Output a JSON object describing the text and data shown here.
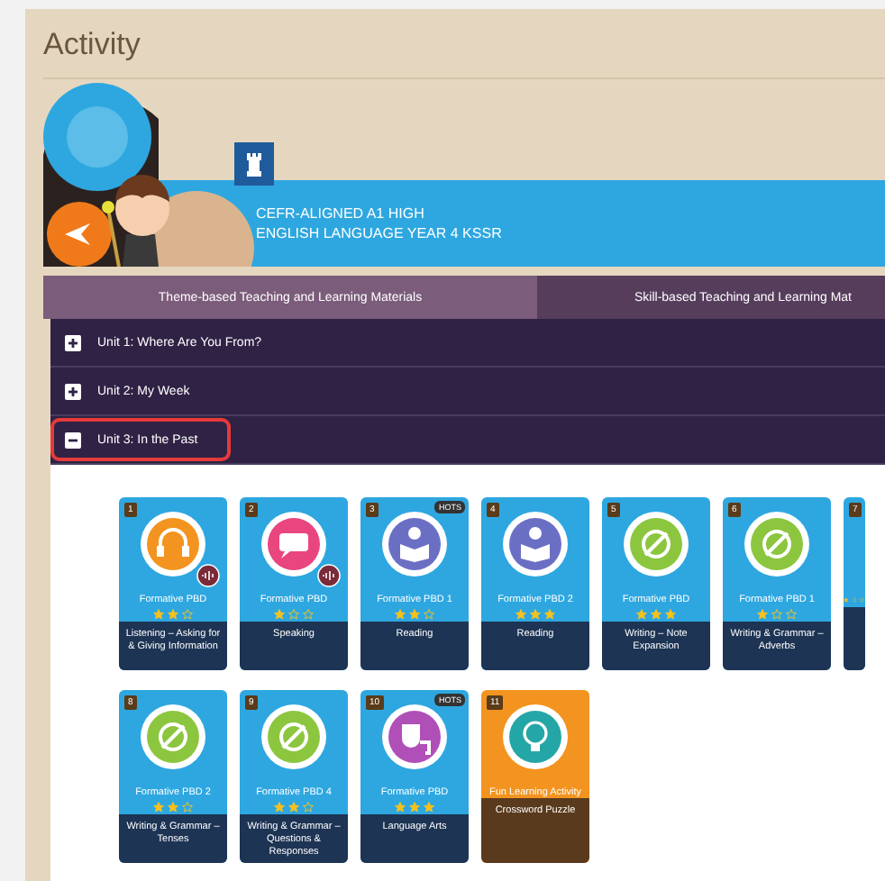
{
  "page": {
    "title": "Activity"
  },
  "banner": {
    "title_lines": [
      "CEFR-ALIGNED A1 HIGH",
      "ENGLISH LANGUAGE YEAR 4 KSSR"
    ]
  },
  "tabs": [
    {
      "label": "Theme-based Teaching and Learning Materials",
      "selected": true
    },
    {
      "label": "Skill-based Teaching and Learning Mat",
      "selected": false
    }
  ],
  "units": [
    {
      "label": "Unit 1: Where Are You From?",
      "expanded": false,
      "highlighted": false
    },
    {
      "label": "Unit 2: My Week",
      "expanded": false,
      "highlighted": false
    },
    {
      "label": "Unit 3: In the Past",
      "expanded": true,
      "highlighted": true
    }
  ],
  "card_rows": [
    [
      {
        "kind": "listening",
        "number": "1",
        "title": "Formative PBD",
        "stars": 2,
        "description": "Listening – Asking for & Giving Information",
        "audio": true
      },
      {
        "kind": "speaking",
        "number": "2",
        "title": "Formative PBD",
        "stars": 1,
        "description": "Speaking",
        "audio": true
      },
      {
        "kind": "reading",
        "number": "3",
        "badge": "HOTS",
        "title": "Formative PBD 1",
        "stars": 2,
        "description": "Reading",
        "audio": false
      },
      {
        "kind": "reading",
        "number": "4",
        "title": "Formative PBD 2",
        "stars": 3,
        "description": "Reading",
        "audio": false
      },
      {
        "kind": "writing",
        "number": "5",
        "title": "Formative PBD",
        "stars": 3,
        "description": "Writing – Note Expansion",
        "audio": false
      },
      {
        "kind": "writing",
        "number": "6",
        "title": "Formative PBD 1",
        "stars": 1,
        "description": "Writing & Grammar – Adverbs",
        "audio": false
      },
      {
        "kind": "partial",
        "number": "7",
        "stars": 1
      }
    ],
    [
      {
        "kind": "writing",
        "number": "8",
        "title": "Formative PBD 2",
        "stars": 2,
        "description": "Writing & Grammar – Tenses",
        "audio": false
      },
      {
        "kind": "writing",
        "number": "9",
        "title": "Formative PBD 4",
        "stars": 2,
        "description": "Writing & Grammar – Questions & Responses",
        "audio": false
      },
      {
        "kind": "arts",
        "number": "10",
        "badge": "HOTS",
        "title": "Formative PBD",
        "stars": 3,
        "description": "Language Arts",
        "audio": false
      },
      {
        "kind": "fun",
        "number": "11",
        "title": "Fun Learning Activity",
        "description": "Crossword Puzzle",
        "audio": false
      }
    ]
  ]
}
